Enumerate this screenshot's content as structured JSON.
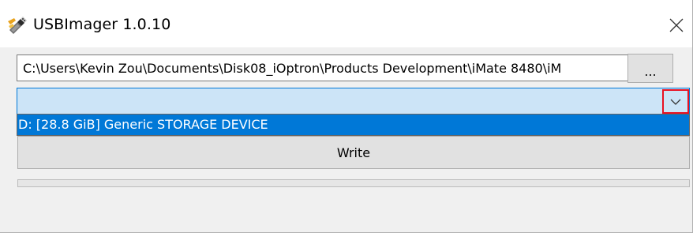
{
  "window": {
    "title": "USBImager 1.0.10",
    "app_icon": "usb-imager-app-icon",
    "close_icon": "close-icon"
  },
  "image_file": {
    "path": "C:\\Users\\Kevin Zou\\Documents\\Disk08_iOptron\\Products Development\\iMate 8480\\iM",
    "browse_label": "..."
  },
  "device": {
    "selected": "",
    "dropdown_icon": "chevron-down-icon",
    "options": [
      "D: [28.8 GiB] Generic STORAGE DEVICE"
    ]
  },
  "actions": {
    "write_label": "Write"
  },
  "progress": {
    "fraction": 0
  },
  "colors": {
    "selection": "#0078d7",
    "select_highlight": "#cce4f7",
    "focus_marker": "#e81123"
  }
}
